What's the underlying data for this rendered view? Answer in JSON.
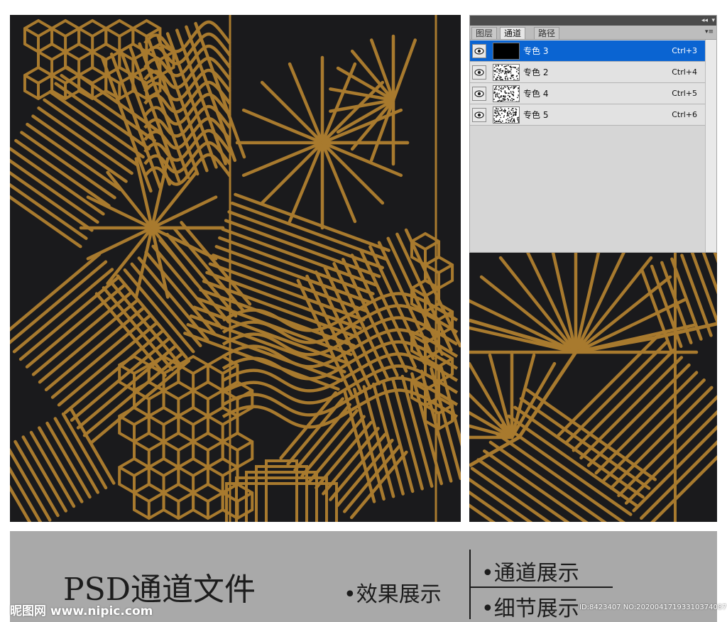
{
  "colors": {
    "background": "#ffffff",
    "pattern_bg": "#1a1a1c",
    "pattern_gold": "#a87a2e",
    "selection_blue": "#0a64d2",
    "caption_band": "#a9a9a9"
  },
  "panel": {
    "collapse_icon": "double-chevron-icon",
    "close_icon": "close-icon",
    "tabs": [
      {
        "label": "图层",
        "active": false
      },
      {
        "label": "通道",
        "active": true
      },
      {
        "label": "路径",
        "active": false
      }
    ],
    "menu_icon": "panel-menu-icon",
    "channels": [
      {
        "name": "专色 3",
        "shortcut": "Ctrl+3",
        "selected": true,
        "thumbnail": "solid-black"
      },
      {
        "name": "专色 2",
        "shortcut": "Ctrl+4",
        "selected": false,
        "thumbnail": "speckle"
      },
      {
        "name": "专色 4",
        "shortcut": "Ctrl+5",
        "selected": false,
        "thumbnail": "speckle"
      },
      {
        "name": "专色 5",
        "shortcut": "Ctrl+6",
        "selected": false,
        "thumbnail": "speckle"
      }
    ]
  },
  "caption": {
    "title": "PSD通道文件",
    "effect_label": "•效果展示",
    "channel_label": "•通道展示",
    "detail_label": "•细节展示"
  },
  "watermark": {
    "site": "昵图网 www.nipic.com",
    "id_text": "ID:8423407 NO:20200417193310374087"
  }
}
